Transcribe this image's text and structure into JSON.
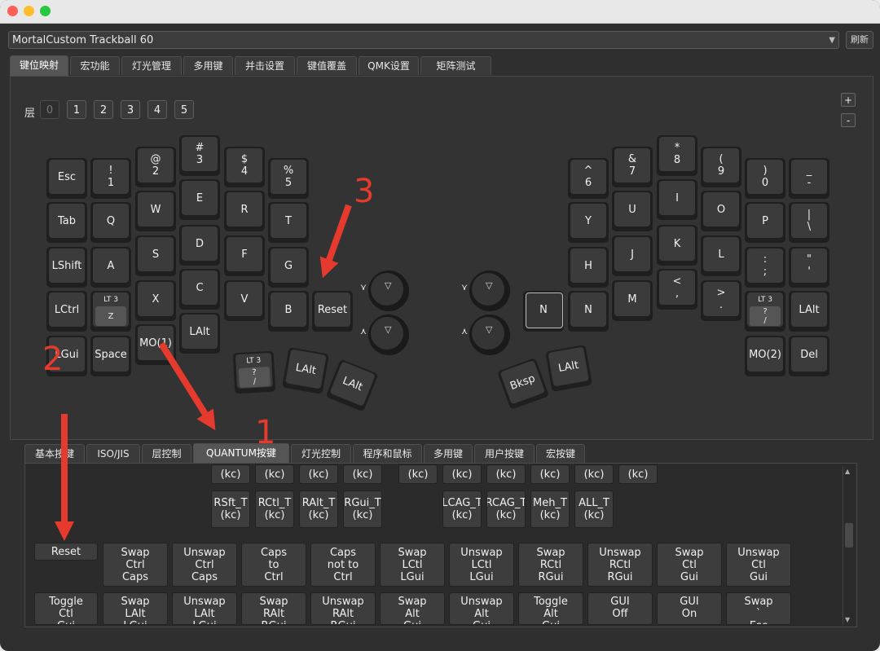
{
  "window": {
    "device": "MortalCustom Trackball 60",
    "refresh_label": "刷新"
  },
  "top_tabs": [
    {
      "label": "键位映射",
      "active": true
    },
    {
      "label": "宏功能"
    },
    {
      "label": "灯光管理"
    },
    {
      "label": "多用键"
    },
    {
      "label": "并击设置"
    },
    {
      "label": "键值覆盖"
    },
    {
      "label": "QMK设置"
    },
    {
      "label": "矩阵测试"
    }
  ],
  "layers": {
    "label": "层",
    "items": [
      "0",
      "1",
      "2",
      "3",
      "4",
      "5"
    ],
    "active": "0"
  },
  "zoom": {
    "plus": "+",
    "minus": "-"
  },
  "keys": {
    "esc": "Esc",
    "k1": "!\n1",
    "k2": "@\n2",
    "k3": "#\n3",
    "k4": "$\n4",
    "k5": "%\n5",
    "tab": "Tab",
    "q": "Q",
    "w": "W",
    "e": "E",
    "r": "R",
    "t": "T",
    "lshift": "LShift",
    "a": "A",
    "s": "S",
    "d": "D",
    "f": "F",
    "g": "G",
    "lctrl": "LCtrl",
    "z_top": "LT 3",
    "z": "Z",
    "x": "X",
    "c": "C",
    "v": "V",
    "b": "B",
    "reset": "Reset",
    "lgui": "LGui",
    "space": "Space",
    "mo1": "MO(1)",
    "lalt_l": "LAlt",
    "t1_top": "LT 3",
    "t1": "?\n/",
    "t2": "LAlt",
    "t3": "LAlt",
    "k6": "^\n6",
    "k7": "&\n7",
    "k8": "*\n8",
    "k9": "(\n9",
    "k0": ")\n0",
    "minus": "_\n-",
    "y": "Y",
    "u": "U",
    "i": "I",
    "o": "O",
    "p": "P",
    "pipe": "|\n\\",
    "h": "H",
    "j": "J",
    "k": "K",
    "l": "L",
    "semi": ":\n;",
    "quote": "\"\n'",
    "n_sel": "N",
    "n": "N",
    "m": "M",
    "comma": "<\n,",
    "dot": ">\n.",
    "slash_top": "LT 3",
    "slash": "?\n/",
    "lalt_r": "LAlt",
    "mo2": "MO(2)",
    "del": "Del",
    "bksp": "Bksp",
    "lalt_r2": "LAlt"
  },
  "knob_icons": {
    "ccw": "chevron-down-icon",
    "cw": "chevron-up-icon",
    "tri": "triangle-down-icon"
  },
  "bottom_tabs": [
    {
      "label": "基本按键"
    },
    {
      "label": "ISO/JIS"
    },
    {
      "label": "层控制"
    },
    {
      "label": "QUANTUM按键",
      "active": true
    },
    {
      "label": "灯光控制"
    },
    {
      "label": "程序和鼠标"
    },
    {
      "label": "多用键"
    },
    {
      "label": "用户按键"
    },
    {
      "label": "宏按键"
    }
  ],
  "quantum": {
    "row0": [
      "(kc)",
      "(kc)",
      "(kc)",
      "(kc)",
      "(kc)",
      "(kc)",
      "(kc)",
      "(kc)",
      "(kc)",
      "(kc)"
    ],
    "row1": [
      "RSft_T\n(kc)",
      "RCtl_T\n(kc)",
      "RAlt_T\n(kc)",
      "RGui_T\n(kc)",
      "LCAG_T\n(kc)",
      "RCAG_T\n(kc)",
      "Meh_T\n(kc)",
      "ALL_T\n(kc)"
    ],
    "reset": "Reset",
    "row2": [
      "Swap\nCtrl\nCaps",
      "Unswap\nCtrl\nCaps",
      "Caps\nto\nCtrl",
      "Caps\nnot to\nCtrl",
      "Swap\nLCtl\nLGui",
      "Unswap\nLCtl\nLGui",
      "Swap\nRCtl\nRGui",
      "Unswap\nRCtl\nRGui",
      "Swap\nCtl\nGui",
      "Unswap\nCtl\nGui"
    ],
    "row3": [
      "Toggle\nCtl\nGui",
      "Swap\nLAlt\nLGui",
      "Unswap\nLAlt\nLGui",
      "Swap\nRAlt\nRGui",
      "Unswap\nRAlt\nRGui",
      "Swap\nAlt\nGui",
      "Unswap\nAlt\nGui",
      "Toggle\nAlt\nGui",
      "GUI\nOff",
      "GUI\nOn",
      "Swap\n`\nEsc"
    ]
  },
  "annotations": [
    "1",
    "2",
    "3"
  ],
  "colors": {
    "annotation": "#e63a2e",
    "background": "#2f2f2f",
    "key": "#3b3b3b"
  }
}
